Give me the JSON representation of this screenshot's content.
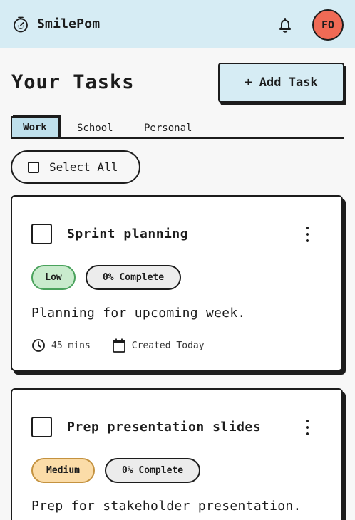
{
  "header": {
    "app_name": "SmilePom",
    "avatar_initials": "FO",
    "avatar_color": "#f06a55",
    "brand_icon": "stopwatch-icon",
    "notification_icon": "bell-icon"
  },
  "page": {
    "title": "Your Tasks",
    "add_task_label": "+ Add Task"
  },
  "tabs": [
    {
      "label": "Work",
      "active": true
    },
    {
      "label": "School",
      "active": false
    },
    {
      "label": "Personal",
      "active": false
    }
  ],
  "select_all_label": "Select All",
  "tasks": [
    {
      "title": "Sprint planning",
      "priority": "Low",
      "progress": "0% Complete",
      "description": "Planning for upcoming week.",
      "duration": "45 mins",
      "created": "Created Today"
    },
    {
      "title": "Prep presentation slides",
      "priority": "Medium",
      "progress": "0% Complete",
      "description": "Prep for stakeholder presentation."
    }
  ],
  "colors": {
    "header_bg": "#d6ecf4",
    "low_pill": "#c9ebcd",
    "medium_pill": "#fbdca8"
  }
}
